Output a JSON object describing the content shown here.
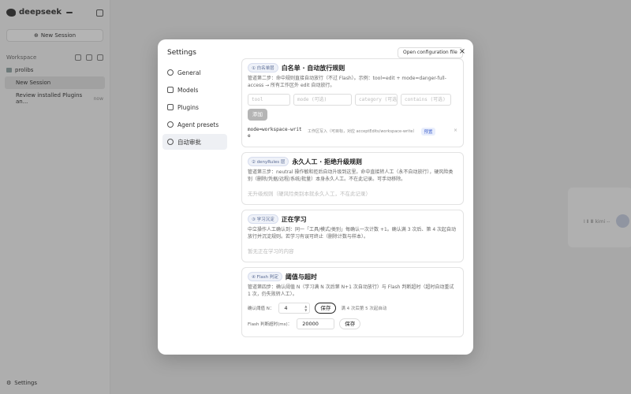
{
  "app": {
    "brand_name": "deepseek",
    "brand_badge": "",
    "new_session": "New Session",
    "workspace_label": "Workspace",
    "tree": [
      {
        "label": "prolibs"
      },
      {
        "label": "New Session"
      },
      {
        "label": "Review installed Plugins an...",
        "meta": "now"
      }
    ],
    "settings_label": "Settings",
    "bg_hint": "Ⅰ Ⅱ Ⅲ kimi --"
  },
  "modal": {
    "title": "Settings",
    "open_config": "Open configuration file",
    "close": "×",
    "nav": [
      {
        "label": "General",
        "icon": "gear-icon"
      },
      {
        "label": "Models",
        "icon": "cube-icon"
      },
      {
        "label": "Plugins",
        "icon": "sliders-icon"
      },
      {
        "label": "Agent presets",
        "icon": "agents-icon"
      },
      {
        "label": "自动审批",
        "icon": "shield-icon"
      }
    ],
    "sections": {
      "allow": {
        "tag": "① 白名单层",
        "title": "白名单 · 自动放行规则",
        "desc": "管道第二步：命中规则直接自动放行（不过 Flash）。示例：tool=edit + mode=danger-full-access → 所有工作区外 edit 自动放行。",
        "ph_tool": "tool",
        "ph_mode": "mode (可选)",
        "ph_category": "category (可选)",
        "ph_contains": "contains (可选)",
        "add": "添加",
        "rule_code": "mode=workspace-write",
        "rule_note": "工作区写入（可目标，对应 acceptEdits/workspace-write）",
        "rule_badge": "预置",
        "rule_del": "×"
      },
      "deny": {
        "tag": "② denyRules 层",
        "title": "永久人工 · 拒绝升级规则",
        "desc": "管道第三步：neutral 操作敏和拒后自动升级到这里。命中直接转人工（永不自动放行），硬风险类别（删除/凭据/远程/系统/批量）本身永久人工。不在此记录。可手动移除。",
        "empty": "无升级规则（硬风险类别本就永久人工，不在此记录）"
      },
      "learning": {
        "tag": "③ 学习沉淀",
        "title": "正在学习",
        "desc": "中立操作人工确认到：同一「工具/模式/类别」每确认一次计数 +1。确认满 3 次后、第 4 次起自动放行并沉淀规则。若学习有误可终止（删除计数与样本）。",
        "empty": "暂无正在学习的内容"
      },
      "flash": {
        "tag": "④ Flash 判定",
        "title": "阈值与超时",
        "desc": "管道第四步：确认阈值 N（学习满 N 次后第 N+1 次自动放行）与 Flash 判断超时（超时自动重试 1 次，仍失败转人工）。",
        "threshold_label": "确认阈值 N：",
        "threshold_value": "4",
        "save": "保存",
        "threshold_hint": "满 4 次后第 5 次起自动",
        "timeout_label": "Flash 判断超时(ms)：",
        "timeout_value": "20000",
        "save2": "保存"
      }
    }
  }
}
